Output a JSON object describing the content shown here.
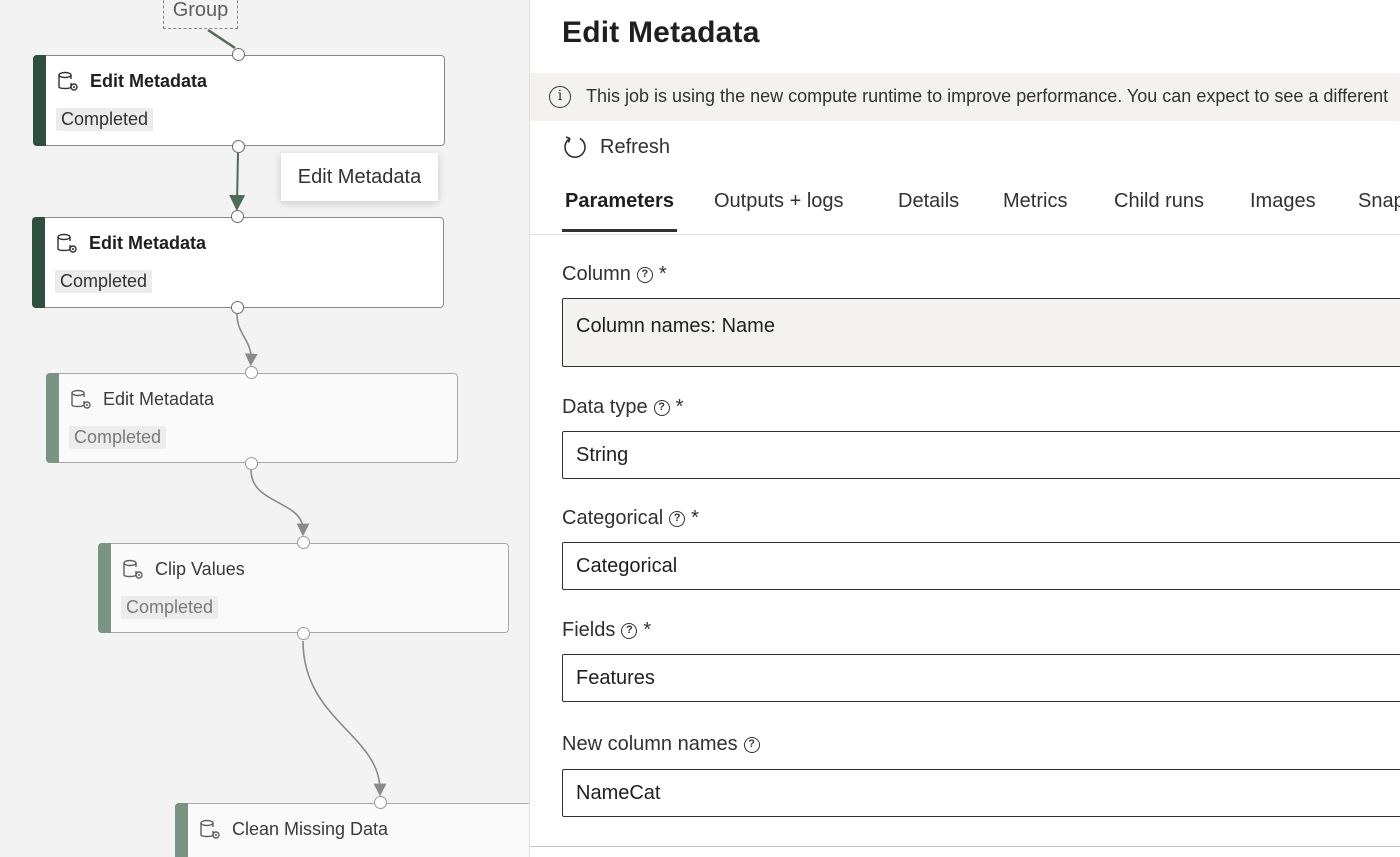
{
  "canvas": {
    "group_label": "Group",
    "tooltip": "Edit Metadata",
    "nodes": [
      {
        "title": "Edit Metadata",
        "status": "Completed",
        "icon": "database-gear-icon"
      },
      {
        "title": "Edit Metadata",
        "status": "Completed",
        "icon": "database-gear-icon"
      },
      {
        "title": "Edit Metadata",
        "status": "Completed",
        "icon": "database-gear-icon"
      },
      {
        "title": "Clip Values",
        "status": "Completed",
        "icon": "database-gear-icon"
      },
      {
        "title": "Clean Missing Data",
        "status": "",
        "icon": "database-gear-icon"
      }
    ],
    "colors": {
      "active_bar": "#2f4f3f",
      "faded_bar": "#7a9484",
      "edge": "#8a8a8a"
    }
  },
  "panel": {
    "title": "Edit Metadata",
    "info": {
      "icon": "info-icon",
      "text": "This job is using the new compute runtime to improve performance. You can expect to see a different"
    },
    "refresh_label": "Refresh",
    "tabs": [
      {
        "label": "Parameters",
        "active": true
      },
      {
        "label": "Outputs + logs",
        "active": false
      },
      {
        "label": "Details",
        "active": false
      },
      {
        "label": "Metrics",
        "active": false
      },
      {
        "label": "Child runs",
        "active": false
      },
      {
        "label": "Images",
        "active": false
      },
      {
        "label": "Snap",
        "active": false
      }
    ],
    "fields": [
      {
        "label": "Column",
        "required": "*",
        "value": "Column names: Name"
      },
      {
        "label": "Data type",
        "required": "*",
        "value": "String"
      },
      {
        "label": "Categorical",
        "required": "*",
        "value": "Categorical"
      },
      {
        "label": "Fields",
        "required": "*",
        "value": "Features"
      },
      {
        "label": "New column names",
        "required": "",
        "value": "NameCat"
      }
    ]
  }
}
